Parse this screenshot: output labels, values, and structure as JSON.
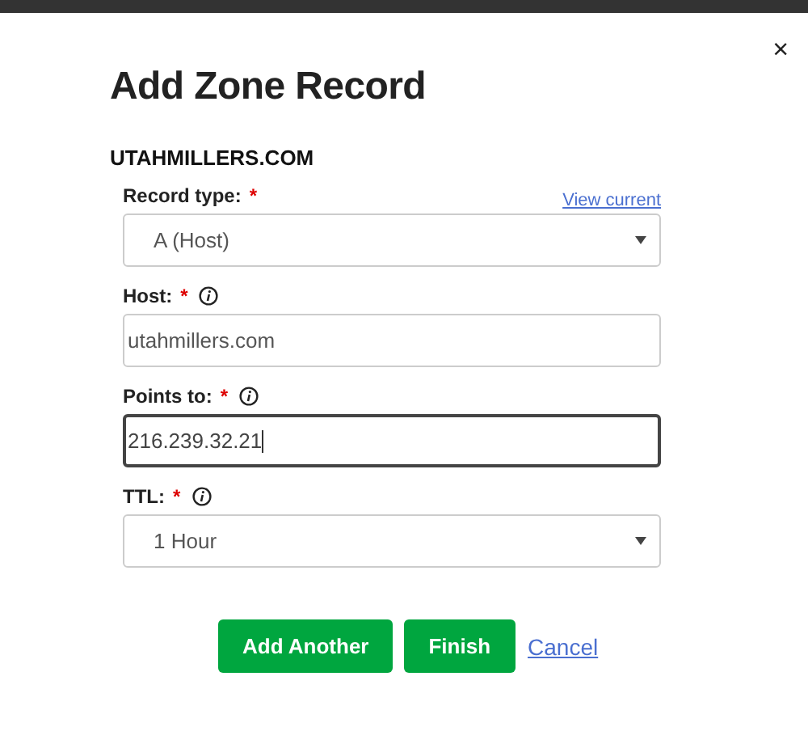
{
  "close": "×",
  "title": "Add Zone Record",
  "domain": "UTAHMILLERS.COM",
  "fields": [
    {
      "kind": "select",
      "label": "Record type:",
      "required_mark": "*",
      "info": false,
      "link": "View current",
      "value": "A (Host)",
      "focused": false
    },
    {
      "kind": "input",
      "label": "Host:",
      "required_mark": "*",
      "info": true,
      "value": "utahmillers.com",
      "focused": false
    },
    {
      "kind": "input",
      "label": "Points to:",
      "required_mark": "*",
      "info": true,
      "value": "216.239.32.21",
      "focused": true
    },
    {
      "kind": "select",
      "label": "TTL:",
      "required_mark": "*",
      "info": true,
      "value": "1 Hour",
      "focused": false
    }
  ],
  "buttons": [
    "Add Another",
    "Finish"
  ],
  "cancel": "Cancel"
}
